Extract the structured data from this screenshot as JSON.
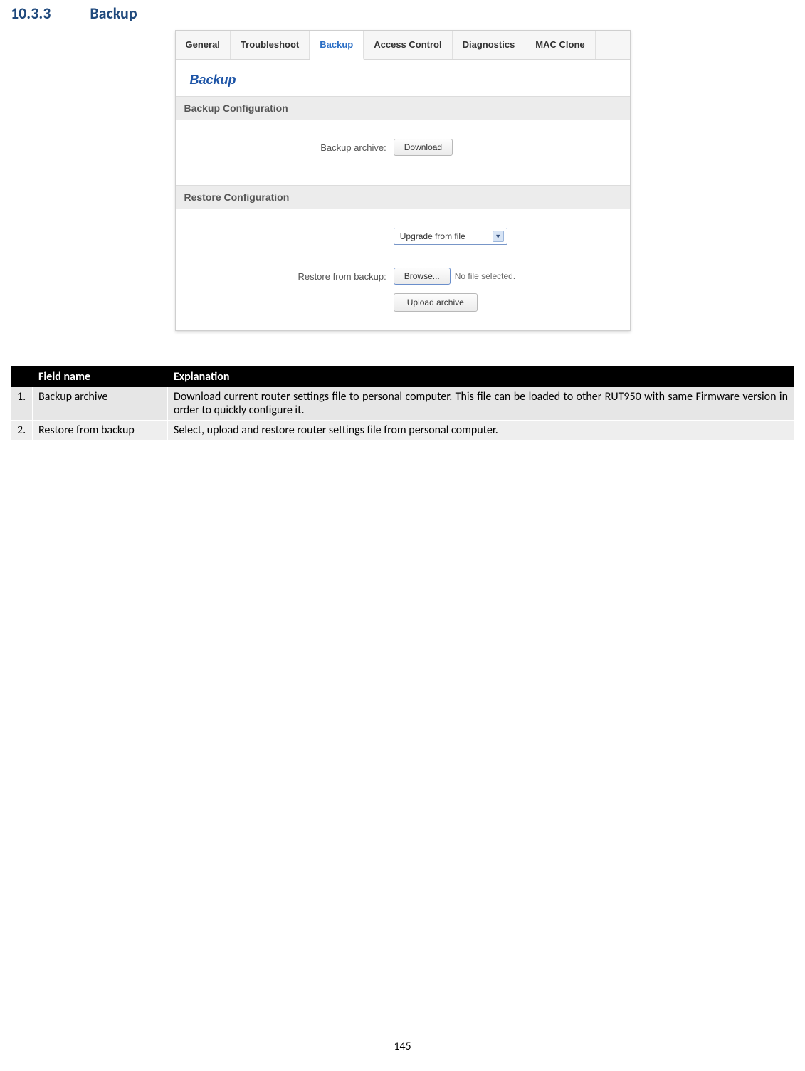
{
  "heading": {
    "number": "10.3.3",
    "title": "Backup"
  },
  "screenshot": {
    "tabs": {
      "general": "General",
      "troubleshoot": "Troubleshoot",
      "backup": "Backup",
      "access_control": "Access Control",
      "diagnostics": "Diagnostics",
      "mac_clone": "MAC Clone"
    },
    "page_title": "Backup",
    "backup_section": {
      "title": "Backup Configuration",
      "archive_label": "Backup archive:",
      "download_btn": "Download"
    },
    "restore_section": {
      "title": "Restore Configuration",
      "select_value": "Upgrade from file",
      "restore_label": "Restore from backup:",
      "browse_btn": "Browse...",
      "no_file": "No file selected.",
      "upload_btn": "Upload archive"
    }
  },
  "table": {
    "headers": {
      "blank": "",
      "field": "Field name",
      "explanation": "Explanation"
    },
    "rows": {
      "r1": {
        "num": "1.",
        "field": "Backup archive",
        "explanation": "Download current router settings file to personal computer. This file can be loaded to other RUT950 with same Firmware version in order to quickly configure it."
      },
      "r2": {
        "num": "2.",
        "field": "Restore from backup",
        "explanation": "Select, upload and restore router settings file from personal computer."
      }
    }
  },
  "page_number": "145"
}
